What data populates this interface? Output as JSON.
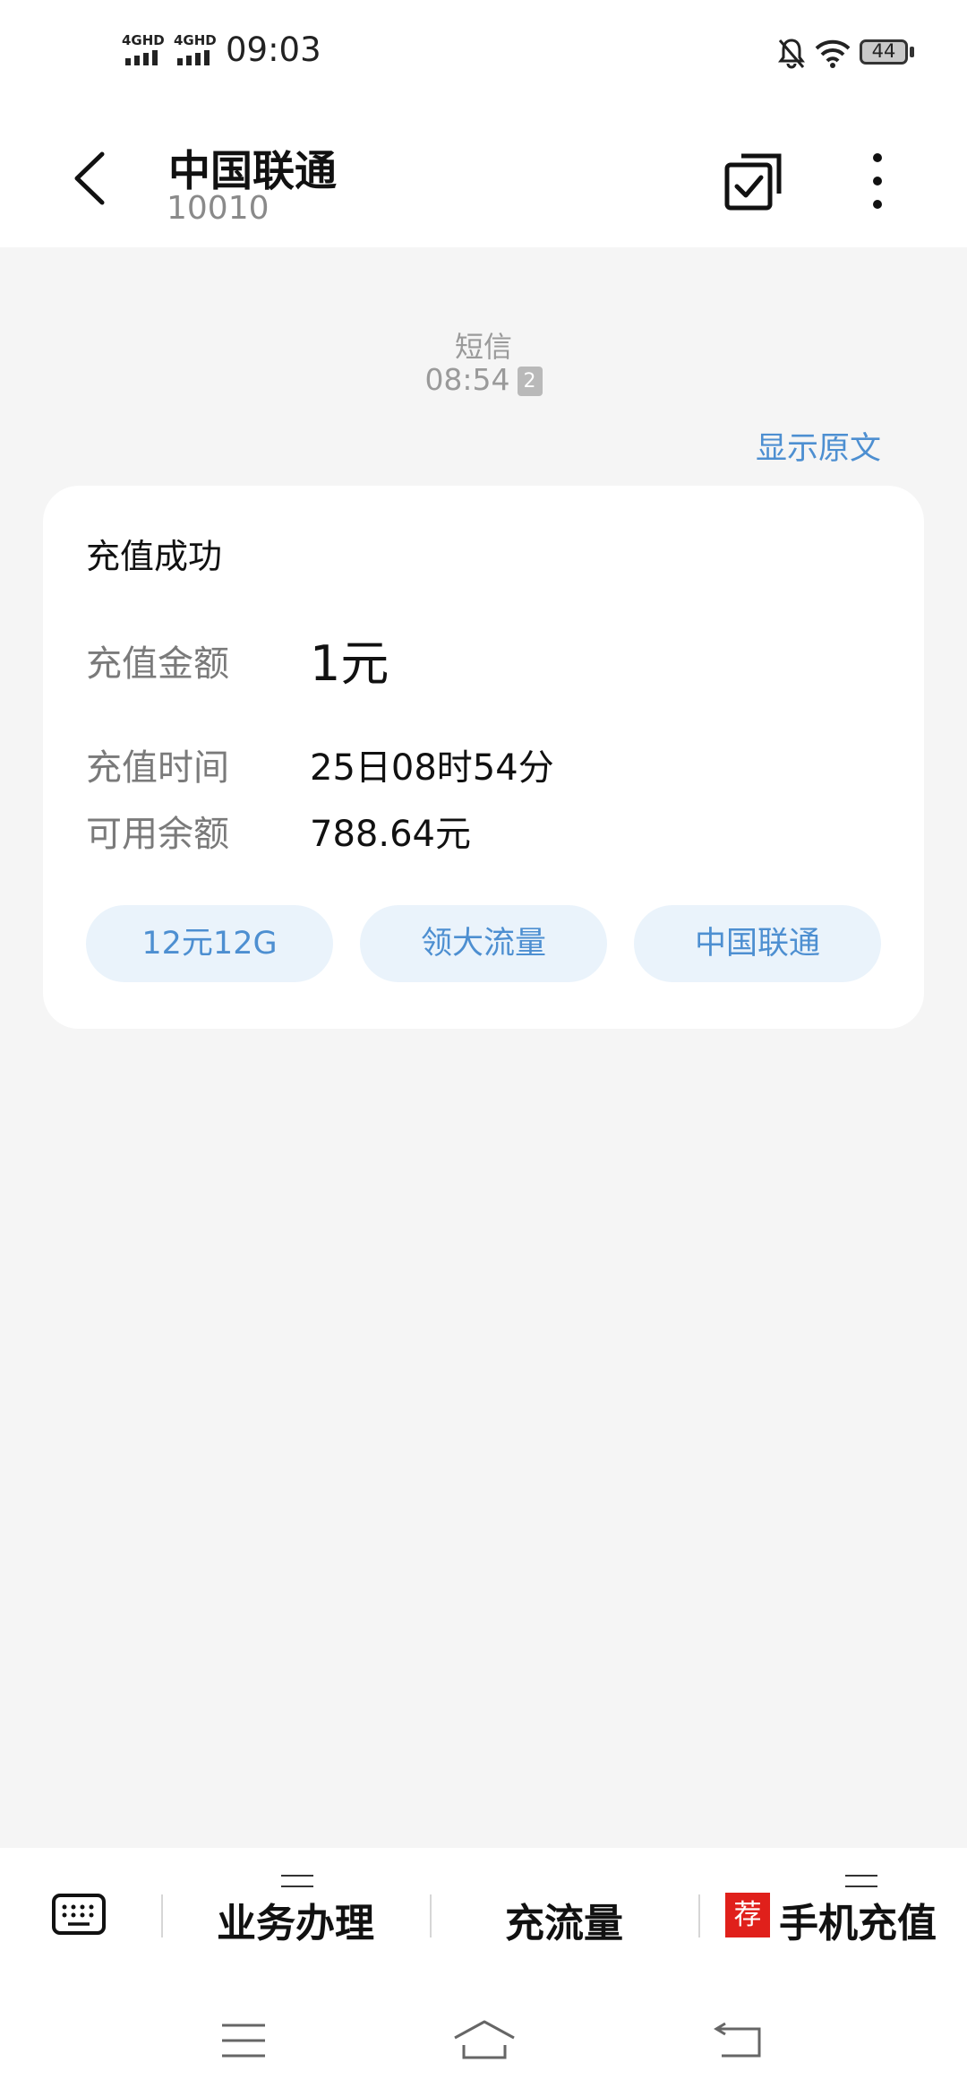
{
  "status_bar": {
    "signal1_label": "4GHD",
    "signal2_label": "4GHD",
    "time": "09:03",
    "battery": "44",
    "icons": [
      "signal-icon",
      "signal-icon",
      "mute-notification-icon",
      "wifi-icon",
      "battery-icon"
    ]
  },
  "header": {
    "title": "中国联通",
    "number": "10010",
    "icons": [
      "back-arrow-icon",
      "multi-select-icon",
      "more-vertical-icon"
    ]
  },
  "message": {
    "type_label": "短信",
    "time": "08:54",
    "sim_slot": "2",
    "show_original": "显示原文"
  },
  "card": {
    "title": "充值成功",
    "rows": [
      {
        "label": "充值金额",
        "value": "1元"
      },
      {
        "label": "充值时间",
        "value": "25日08时54分"
      },
      {
        "label": "可用余额",
        "value": "788.64元"
      }
    ],
    "chips": [
      "12元12G",
      "领大流量",
      "中国联通"
    ]
  },
  "bottom_menu": {
    "items": [
      {
        "label": "业务办理",
        "has_submenu": true
      },
      {
        "label": "充流量",
        "has_submenu": false
      },
      {
        "label": "手机充值",
        "has_submenu": true,
        "badge": "荐"
      }
    ],
    "badge_color": "#e0201b"
  },
  "nav_bar": {
    "icons": [
      "menu-nav-icon",
      "home-nav-icon",
      "back-nav-icon"
    ]
  },
  "colors": {
    "accent": "#4d8fd1",
    "chip_bg": "#eaf3fb",
    "background": "#f5f5f5"
  }
}
